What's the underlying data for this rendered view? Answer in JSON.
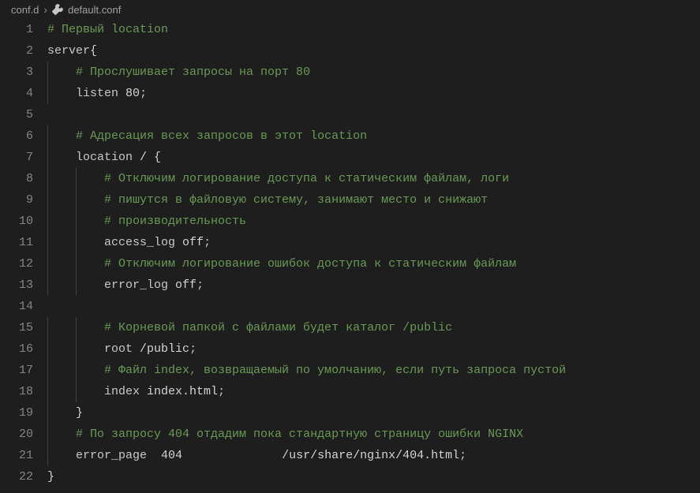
{
  "breadcrumb": {
    "folder": "conf.d",
    "file": "default.conf"
  },
  "lines": [
    {
      "num": 1,
      "indent": 0,
      "guides": [],
      "tokens": [
        {
          "t": "# Первый location",
          "c": "comment"
        }
      ]
    },
    {
      "num": 2,
      "indent": 0,
      "guides": [],
      "tokens": [
        {
          "t": "server",
          "c": "keyword"
        },
        {
          "t": "{",
          "c": "brace"
        }
      ]
    },
    {
      "num": 3,
      "indent": 1,
      "guides": [
        0
      ],
      "tokens": [
        {
          "t": "# Прослушивает запросы на порт 80",
          "c": "comment"
        }
      ]
    },
    {
      "num": 4,
      "indent": 1,
      "guides": [
        0
      ],
      "tokens": [
        {
          "t": "listen",
          "c": "keyword"
        },
        {
          "t": " ",
          "c": "plain"
        },
        {
          "t": "80",
          "c": "plain"
        },
        {
          "t": ";",
          "c": "punct"
        }
      ]
    },
    {
      "num": 5,
      "indent": 0,
      "guides": [],
      "tokens": []
    },
    {
      "num": 6,
      "indent": 1,
      "guides": [
        0
      ],
      "tokens": [
        {
          "t": "# Адресация всех запросов в этот location",
          "c": "comment"
        }
      ]
    },
    {
      "num": 7,
      "indent": 1,
      "guides": [
        0
      ],
      "tokens": [
        {
          "t": "location",
          "c": "keyword"
        },
        {
          "t": " / ",
          "c": "plain"
        },
        {
          "t": "{",
          "c": "brace"
        }
      ]
    },
    {
      "num": 8,
      "indent": 2,
      "guides": [
        0,
        1
      ],
      "tokens": [
        {
          "t": "# Отключим логирование доступа к статическим файлам, логи",
          "c": "comment"
        }
      ]
    },
    {
      "num": 9,
      "indent": 2,
      "guides": [
        0,
        1
      ],
      "tokens": [
        {
          "t": "# пишутся в файловую систему, занимают место и снижают",
          "c": "comment"
        }
      ]
    },
    {
      "num": 10,
      "indent": 2,
      "guides": [
        0,
        1
      ],
      "tokens": [
        {
          "t": "# производительность",
          "c": "comment"
        }
      ]
    },
    {
      "num": 11,
      "indent": 2,
      "guides": [
        0,
        1
      ],
      "tokens": [
        {
          "t": "access_log",
          "c": "keyword"
        },
        {
          "t": " ",
          "c": "plain"
        },
        {
          "t": "off",
          "c": "plain"
        },
        {
          "t": ";",
          "c": "punct"
        }
      ]
    },
    {
      "num": 12,
      "indent": 2,
      "guides": [
        0,
        1
      ],
      "tokens": [
        {
          "t": "# Отключим логирование ошибок доступа к статическим файлам",
          "c": "comment"
        }
      ]
    },
    {
      "num": 13,
      "indent": 2,
      "guides": [
        0,
        1
      ],
      "tokens": [
        {
          "t": "error_log",
          "c": "keyword"
        },
        {
          "t": " ",
          "c": "plain"
        },
        {
          "t": "off",
          "c": "plain"
        },
        {
          "t": ";",
          "c": "punct"
        }
      ]
    },
    {
      "num": 14,
      "indent": 0,
      "guides": [],
      "tokens": []
    },
    {
      "num": 15,
      "indent": 2,
      "guides": [
        0,
        1
      ],
      "tokens": [
        {
          "t": "# Корневой папкой с файлами будет каталог /public",
          "c": "comment"
        }
      ]
    },
    {
      "num": 16,
      "indent": 2,
      "guides": [
        0,
        1
      ],
      "tokens": [
        {
          "t": "root",
          "c": "keyword"
        },
        {
          "t": " ",
          "c": "plain"
        },
        {
          "t": "/public",
          "c": "plain"
        },
        {
          "t": ";",
          "c": "punct"
        }
      ]
    },
    {
      "num": 17,
      "indent": 2,
      "guides": [
        0,
        1
      ],
      "tokens": [
        {
          "t": "# Файл index, возвращаемый по умолчанию, если путь запроса пустой",
          "c": "comment"
        }
      ]
    },
    {
      "num": 18,
      "indent": 2,
      "guides": [
        0,
        1
      ],
      "tokens": [
        {
          "t": "index",
          "c": "keyword"
        },
        {
          "t": " ",
          "c": "plain"
        },
        {
          "t": "index.html",
          "c": "plain"
        },
        {
          "t": ";",
          "c": "punct"
        }
      ]
    },
    {
      "num": 19,
      "indent": 1,
      "guides": [
        0
      ],
      "tokens": [
        {
          "t": "}",
          "c": "brace"
        }
      ]
    },
    {
      "num": 20,
      "indent": 1,
      "guides": [
        0
      ],
      "tokens": [
        {
          "t": "# По запросу 404 отдадим пока стандартную страницу ошибки NGINX",
          "c": "comment"
        }
      ]
    },
    {
      "num": 21,
      "indent": 1,
      "guides": [
        0
      ],
      "tokens": [
        {
          "t": "error_page",
          "c": "keyword"
        },
        {
          "t": "  ",
          "c": "plain"
        },
        {
          "t": "404",
          "c": "plain"
        },
        {
          "t": "              ",
          "c": "plain"
        },
        {
          "t": "/usr/share/nginx/404.html",
          "c": "plain"
        },
        {
          "t": ";",
          "c": "punct"
        }
      ]
    },
    {
      "num": 22,
      "indent": 0,
      "guides": [],
      "tokens": [
        {
          "t": "}",
          "c": "brace"
        }
      ]
    }
  ],
  "indentWidth": 4
}
